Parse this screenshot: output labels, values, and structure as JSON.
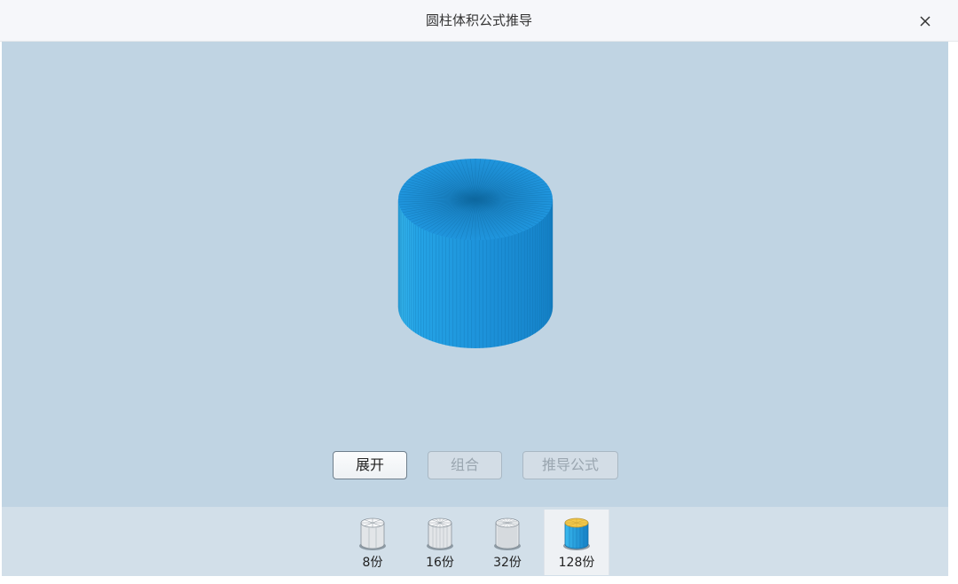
{
  "window": {
    "title": "圆柱体积公式推导"
  },
  "buttons": {
    "expand": "展开",
    "combine": "组合",
    "derive": "推导公式"
  },
  "segments": [
    {
      "label": "8份",
      "icon": "cylinder-8-icon"
    },
    {
      "label": "16份",
      "icon": "cylinder-16-icon"
    },
    {
      "label": "32份",
      "icon": "cylinder-32-icon"
    },
    {
      "label": "128份",
      "icon": "cylinder-128-icon",
      "selected": true
    }
  ],
  "colors": {
    "stage_bg": "#c0d4e3",
    "cylinder_blue": "#1d8fd9",
    "selected_top": "#f2c84b"
  }
}
